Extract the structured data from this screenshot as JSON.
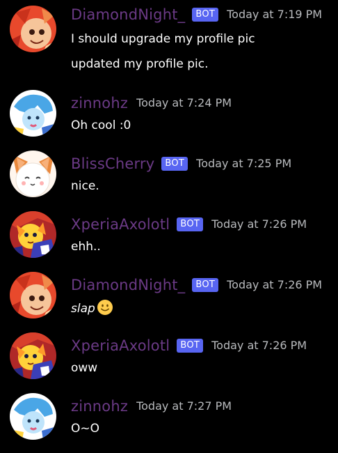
{
  "bot_badge": "BOT",
  "colors": {
    "background": "#000000",
    "username": "#6b3a86",
    "timestamp": "#b9bbbe",
    "message_text": "#ffffff",
    "bot_badge": "#5865f2"
  },
  "messages": [
    {
      "username": "DiamondNight_",
      "bot": true,
      "timestamp": "Today at 7:19 PM",
      "lines": [
        "I should upgrade my profile pic",
        "updated my profile pic."
      ],
      "avatar": "diamondnight-avatar"
    },
    {
      "username": "zinnohz",
      "bot": false,
      "timestamp": "Today at 7:24 PM",
      "lines": [
        "Oh cool :0"
      ],
      "avatar": "zinnohz-avatar"
    },
    {
      "username": "BlissCherry",
      "bot": true,
      "timestamp": "Today at 7:25 PM",
      "lines": [
        "nice."
      ],
      "avatar": "blisscherry-avatar"
    },
    {
      "username": "XperiaAxolotl",
      "bot": true,
      "timestamp": "Today at 7:26 PM",
      "lines": [
        "ehh.."
      ],
      "avatar": "xperiaaxolotl-avatar"
    },
    {
      "username": "DiamondNight_",
      "bot": true,
      "timestamp": "Today at 7:26 PM",
      "lines": [
        "slap"
      ],
      "emoji": "slightly-smiling-face-emoji",
      "avatar": "diamondnight-avatar"
    },
    {
      "username": "XperiaAxolotl",
      "bot": true,
      "timestamp": "Today at 7:26 PM",
      "lines": [
        "oww"
      ],
      "avatar": "xperiaaxolotl-avatar"
    },
    {
      "username": "zinnohz",
      "bot": false,
      "timestamp": "Today at 7:27 PM",
      "lines": [
        "O~O"
      ],
      "avatar": "zinnohz-avatar"
    }
  ]
}
